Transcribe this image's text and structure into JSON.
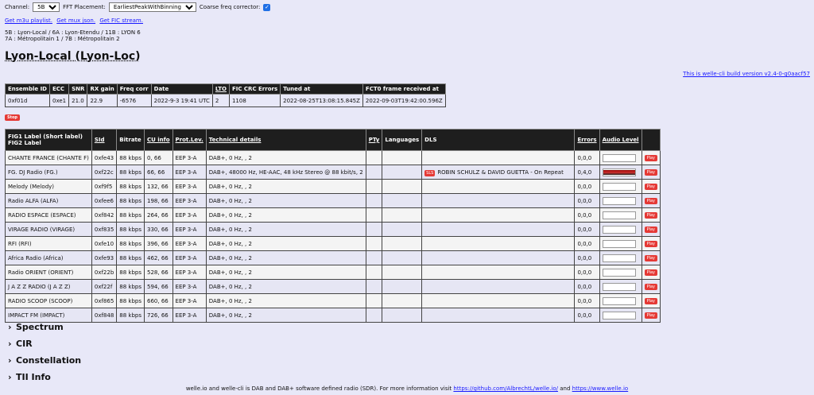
{
  "topbar": {
    "channel_label": "Channel:",
    "channel_value": "5B",
    "fft_label": "FFT Placement:",
    "fft_value": "EarliestPeakWithBinning",
    "coarse_label": "Coarse freq corrector:",
    "coarse_checked": "✓"
  },
  "links": {
    "m3u": "Get m3u playlist.",
    "mux": "Get mux json.",
    "fic": "Get FIC stream."
  },
  "mux_list": {
    "line1": "5B : Lyon-Local / 6A : Lyon-Etendu / 11B : LYON 6",
    "line2": "7A : Métropolitain 1 / 7B : Métropolitain 2"
  },
  "title": "Lyon-Local (Lyon-Loc)",
  "build": "This is welle-cli build version v2.4-0-g0aacf57",
  "ensemble": {
    "headers": [
      "Ensemble ID",
      "ECC",
      "SNR",
      "RX gain",
      "Freq corr",
      "Date",
      "LTO",
      "FIC CRC Errors",
      "Tuned at",
      "FCT0 frame received at"
    ],
    "values": [
      "0xf01d",
      "0xe1",
      "21.0",
      "22.9",
      "-6576",
      "2022-9-3 19:41 UTC",
      "2",
      "1108",
      "2022-08-25T13:08:15.845Z",
      "2022-09-03T19:42:00.596Z"
    ]
  },
  "stop_label": "Stop",
  "services": {
    "headers": {
      "label1": "FIG1 Label (Short label)",
      "label2": "FIG2 Label",
      "sid": "SId",
      "bitrate": "Bitrate",
      "cu": "CU info",
      "prot": "Prot.Lev.",
      "tech": "Technical details",
      "pty": "PTy",
      "lang": "Languages",
      "dls": "DLS",
      "errors": "Errors",
      "audio": "Audio Level",
      "play": ""
    },
    "play_label": "Play",
    "sls_label": "SLS",
    "rows": [
      {
        "label": "CHANTE FRANCE (CHANTE F)",
        "sid": "0xfe43",
        "bitrate": "88 kbps",
        "cu": "0, 66",
        "prot": "EEP 3-A",
        "tech": "DAB+, 0 Hz, , 2",
        "dls": "",
        "errors": "0,0,0",
        "level": 0
      },
      {
        "label": "FG. DJ Radio (FG.)",
        "sid": "0xf22c",
        "bitrate": "88 kbps",
        "cu": "66, 66",
        "prot": "EEP 3-A",
        "tech": "DAB+, 48000 Hz, HE-AAC, 48 kHz Stereo @ 88 kbit/s, 2",
        "dls": "ROBIN SCHULZ & DAVID GUETTA - On Repeat",
        "errors": "0,4,0",
        "level": 1
      },
      {
        "label": "Melody (Melody)",
        "sid": "0xf9f5",
        "bitrate": "88 kbps",
        "cu": "132, 66",
        "prot": "EEP 3-A",
        "tech": "DAB+, 0 Hz, , 2",
        "dls": "",
        "errors": "0,0,0",
        "level": 0
      },
      {
        "label": "Radio ALFA (ALFA)",
        "sid": "0xfee6",
        "bitrate": "88 kbps",
        "cu": "198, 66",
        "prot": "EEP 3-A",
        "tech": "DAB+, 0 Hz, , 2",
        "dls": "",
        "errors": "0,0,0",
        "level": 0
      },
      {
        "label": "RADIO ESPACE (ESPACE)",
        "sid": "0xf842",
        "bitrate": "88 kbps",
        "cu": "264, 66",
        "prot": "EEP 3-A",
        "tech": "DAB+, 0 Hz, , 2",
        "dls": "",
        "errors": "0,0,0",
        "level": 0
      },
      {
        "label": "VIRAGE RADIO (VIRAGE)",
        "sid": "0xf835",
        "bitrate": "88 kbps",
        "cu": "330, 66",
        "prot": "EEP 3-A",
        "tech": "DAB+, 0 Hz, , 2",
        "dls": "",
        "errors": "0,0,0",
        "level": 0
      },
      {
        "label": "RFI (RFI)",
        "sid": "0xfe10",
        "bitrate": "88 kbps",
        "cu": "396, 66",
        "prot": "EEP 3-A",
        "tech": "DAB+, 0 Hz, , 2",
        "dls": "",
        "errors": "0,0,0",
        "level": 0
      },
      {
        "label": "Africa Radio (Africa)",
        "sid": "0xfe93",
        "bitrate": "88 kbps",
        "cu": "462, 66",
        "prot": "EEP 3-A",
        "tech": "DAB+, 0 Hz, , 2",
        "dls": "",
        "errors": "0,0,0",
        "level": 0
      },
      {
        "label": "Radio ORIENT (ORIENT)",
        "sid": "0xf22b",
        "bitrate": "88 kbps",
        "cu": "528, 66",
        "prot": "EEP 3-A",
        "tech": "DAB+, 0 Hz, , 2",
        "dls": "",
        "errors": "0,0,0",
        "level": 0
      },
      {
        "label": "J A Z Z RADIO (J A Z Z)",
        "sid": "0xf22f",
        "bitrate": "88 kbps",
        "cu": "594, 66",
        "prot": "EEP 3-A",
        "tech": "DAB+, 0 Hz, , 2",
        "dls": "",
        "errors": "0,0,0",
        "level": 0
      },
      {
        "label": "RADIO SCOOP (SCOOP)",
        "sid": "0xf865",
        "bitrate": "88 kbps",
        "cu": "660, 66",
        "prot": "EEP 3-A",
        "tech": "DAB+, 0 Hz, , 2",
        "dls": "",
        "errors": "0,0,0",
        "level": 0
      },
      {
        "label": "IMPACT FM (IMPACT)",
        "sid": "0xf848",
        "bitrate": "88 kbps",
        "cu": "726, 66",
        "prot": "EEP 3-A",
        "tech": "DAB+, 0 Hz, , 2",
        "dls": "",
        "errors": "0,0,0",
        "level": 0
      }
    ]
  },
  "sections": [
    "Spectrum",
    "CIR",
    "Constellation",
    "TII Info"
  ],
  "footer": {
    "text": "welle.io and welle-cli is DAB and DAB+ software defined radio (SDR). For more information visit",
    "link1": "https://github.com/AlbrechtL/welle.io/",
    "and": "and",
    "link2": "https://www.welle.io"
  }
}
